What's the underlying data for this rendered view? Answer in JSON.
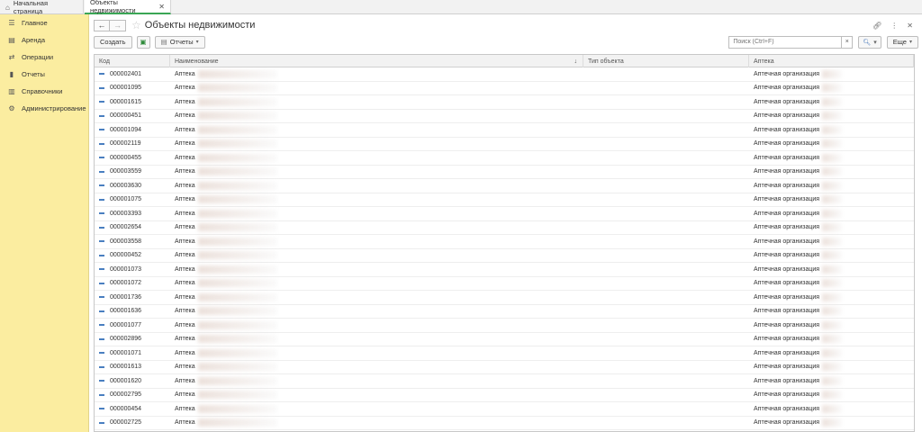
{
  "tabs": {
    "home_label": "Начальная страница",
    "active_label": "Объекты недвижимости"
  },
  "sidebar": {
    "items": [
      {
        "label": "Главное",
        "icon": "menu-lines-icon"
      },
      {
        "label": "Аренда",
        "icon": "book-icon"
      },
      {
        "label": "Операции",
        "icon": "operations-icon"
      },
      {
        "label": "Отчеты",
        "icon": "bar-chart-icon"
      },
      {
        "label": "Справочники",
        "icon": "reference-book-icon"
      },
      {
        "label": "Администрирование",
        "icon": "gear-icon"
      }
    ]
  },
  "header": {
    "title": "Объекты недвижимости"
  },
  "toolbar": {
    "create_label": "Создать",
    "reports_label": "Отчеты",
    "search_placeholder": "Поиск (Ctrl+F)",
    "more_label": "Еще"
  },
  "table": {
    "columns": [
      "Код",
      "Наименование",
      "Тип объекта",
      "Аптека"
    ],
    "rows": [
      {
        "code": "000002401",
        "name": "Аптека",
        "type": "",
        "pharmacy": "Аптечная организация"
      },
      {
        "code": "000001095",
        "name": "Аптека",
        "type": "",
        "pharmacy": "Аптечная организация"
      },
      {
        "code": "000001615",
        "name": "Аптека",
        "type": "",
        "pharmacy": "Аптечная организация"
      },
      {
        "code": "000000451",
        "name": "Аптека",
        "type": "",
        "pharmacy": "Аптечная организация"
      },
      {
        "code": "000001094",
        "name": "Аптека",
        "type": "",
        "pharmacy": "Аптечная организация"
      },
      {
        "code": "000002119",
        "name": "Аптека",
        "type": "",
        "pharmacy": "Аптечная организация"
      },
      {
        "code": "000000455",
        "name": "Аптека",
        "type": "",
        "pharmacy": "Аптечная организация"
      },
      {
        "code": "000003559",
        "name": "Аптека",
        "type": "",
        "pharmacy": "Аптечная организация"
      },
      {
        "code": "000003630",
        "name": "Аптека",
        "type": "",
        "pharmacy": "Аптечная организация"
      },
      {
        "code": "000001075",
        "name": "Аптека",
        "type": "",
        "pharmacy": "Аптечная организация"
      },
      {
        "code": "000003393",
        "name": "Аптека",
        "type": "",
        "pharmacy": "Аптечная организация"
      },
      {
        "code": "000002654",
        "name": "Аптека",
        "type": "",
        "pharmacy": "Аптечная организация"
      },
      {
        "code": "000003558",
        "name": "Аптека",
        "type": "",
        "pharmacy": "Аптечная организация"
      },
      {
        "code": "000000452",
        "name": "Аптека",
        "type": "",
        "pharmacy": "Аптечная организация"
      },
      {
        "code": "000001073",
        "name": "Аптека",
        "type": "",
        "pharmacy": "Аптечная организация"
      },
      {
        "code": "000001072",
        "name": "Аптека",
        "type": "",
        "pharmacy": "Аптечная организация"
      },
      {
        "code": "000001736",
        "name": "Аптека",
        "type": "",
        "pharmacy": "Аптечная организация"
      },
      {
        "code": "000001636",
        "name": "Аптека",
        "type": "",
        "pharmacy": "Аптечная организация"
      },
      {
        "code": "000001077",
        "name": "Аптека",
        "type": "",
        "pharmacy": "Аптечная организация"
      },
      {
        "code": "000002896",
        "name": "Аптека",
        "type": "",
        "pharmacy": "Аптечная организация"
      },
      {
        "code": "000001071",
        "name": "Аптека",
        "type": "",
        "pharmacy": "Аптечная организация"
      },
      {
        "code": "000001613",
        "name": "Аптека",
        "type": "",
        "pharmacy": "Аптечная организация"
      },
      {
        "code": "000001620",
        "name": "Аптека",
        "type": "",
        "pharmacy": "Аптечная организация"
      },
      {
        "code": "000002795",
        "name": "Аптека",
        "type": "",
        "pharmacy": "Аптечная организация"
      },
      {
        "code": "000000454",
        "name": "Аптека",
        "type": "",
        "pharmacy": "Аптечная организация"
      },
      {
        "code": "000002725",
        "name": "Аптека",
        "type": "",
        "pharmacy": "Аптечная организация"
      }
    ]
  }
}
